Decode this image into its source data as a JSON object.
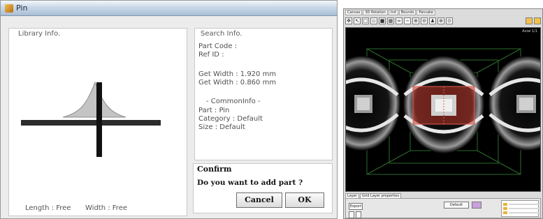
{
  "dialog": {
    "title": "Pin",
    "library": {
      "legend": "Library Info.",
      "length_label": "Length : Free",
      "width_label": "Width : Free"
    },
    "search": {
      "legend": "Search Info.",
      "part_code": "Part Code :",
      "ref_id": "Ref ID :",
      "get_width_1": "Get Width : 1.920 mm",
      "get_width_2": "Get Width : 0.860 mm",
      "common_info": "- CommonInfo -",
      "part": "Part : Pin",
      "category": "Category : Default",
      "size": "Size : Default"
    },
    "confirm": {
      "title": "Confirm",
      "question": "Do you want to add part ?",
      "cancel_label": "Cancel",
      "ok_label": "OK"
    }
  },
  "app": {
    "tabs": [
      "Canvas",
      "3D Rotation",
      "Ind",
      "Bounds",
      "Pancake"
    ],
    "toolbar_icons": [
      "move-icon",
      "pan-icon",
      "select-box-icon",
      "frame-icon",
      "fill-icon",
      "grid-icon",
      "line-icon",
      "minus-icon",
      "zoom-icon",
      "zoom-out-icon",
      "person-icon",
      "zoom-in-icon",
      "zoom-fit-icon",
      "folder-icon",
      "save-icon"
    ],
    "viewport_label": "Axial 1/1",
    "lower_tabs": [
      "Layer",
      "Grid Layer properties"
    ],
    "lower_buttons": {
      "export": "Export",
      "default": "Default"
    },
    "colors": {
      "highlight": "#c0392b",
      "viewport_bg": "#000000"
    }
  }
}
